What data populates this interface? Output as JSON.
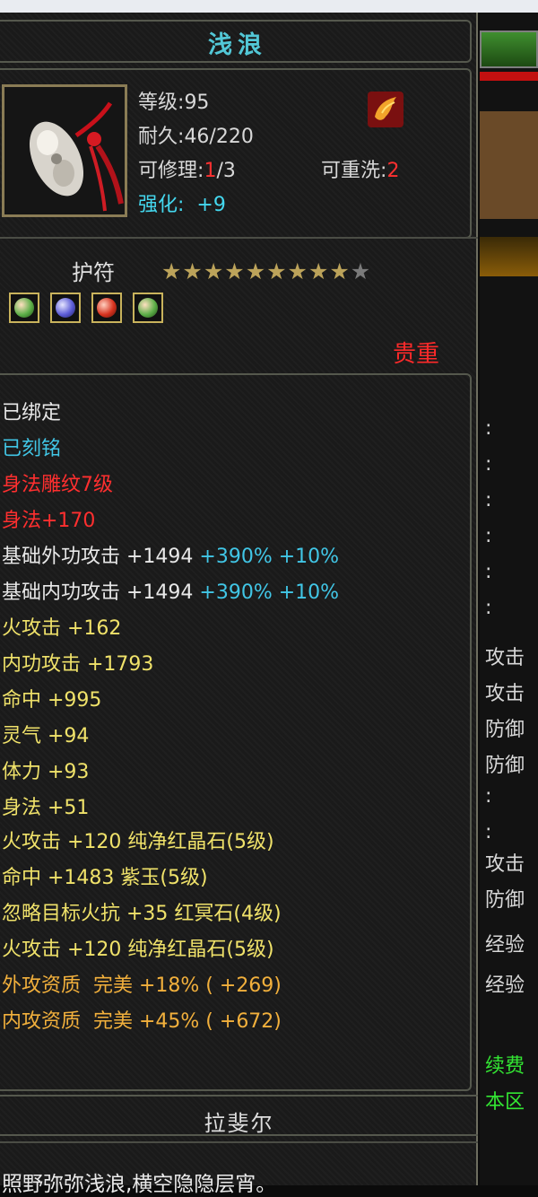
{
  "item": {
    "name": "浅浪",
    "level_label": "等级",
    "level_value": "95",
    "durability_label": "耐久",
    "durability_value": "46/220",
    "repair_label": "可修理",
    "repair_used": "1",
    "repair_max": "/3",
    "rewash_label": "可重洗",
    "rewash_value": "2",
    "enhance_label": "强化",
    "enhance_value": "+9",
    "type": "护符",
    "stars_filled": 9,
    "stars_total": 10,
    "rarity": "贵重",
    "gems": [
      "green-gem",
      "blue-gem",
      "red-gem",
      "green-gem"
    ],
    "icon": "jade-pendant-icon",
    "badge_icon": "phoenix-badge-icon"
  },
  "attributes": [
    {
      "text": "已绑定",
      "color": "white"
    },
    {
      "text": "已刻铭",
      "color": "cyan"
    },
    {
      "text": "身法雕纹7级",
      "color": "red"
    },
    {
      "text": "身法+170",
      "color": "red"
    },
    {
      "text": "基础外功攻击 +1494",
      "color": "white",
      "extra": " +390% +10%"
    },
    {
      "text": "基础内功攻击 +1494",
      "color": "white",
      "extra": " +390% +10%"
    },
    {
      "text": "火攻击 +162",
      "color": "yellow"
    },
    {
      "text": "内功攻击 +1793",
      "color": "yellow"
    },
    {
      "text": "命中 +995",
      "color": "yellow"
    },
    {
      "text": "灵气 +94",
      "color": "yellow"
    },
    {
      "text": "体力 +93",
      "color": "yellow"
    },
    {
      "text": "身法 +51",
      "color": "yellow"
    },
    {
      "text": "火攻击 +120 纯净红晶石(5级)",
      "color": "yellow"
    },
    {
      "text": "命中 +1483 紫玉(5级)",
      "color": "yellow"
    },
    {
      "text": "忽略目标火抗 +35 红冥石(4级)",
      "color": "yellow"
    },
    {
      "text": "火攻击 +120 纯净红晶石(5级)",
      "color": "yellow"
    },
    {
      "text": "外攻资质  完美 +18% ( +269)",
      "color": "gold"
    },
    {
      "text": "内攻资质  完美 +45% ( +672)",
      "color": "gold"
    }
  ],
  "owner": "拉斐尔",
  "description": "照野弥弥浅浪,横空隐隐层宵。",
  "background_window": {
    "labels": [
      "攻击",
      "攻击",
      "防御",
      "防御",
      "攻击",
      "防御",
      "经验",
      "经验",
      "续费",
      "本区"
    ],
    "colons": [
      ":",
      ":",
      ":",
      ":",
      ":",
      ":",
      ":",
      ":"
    ]
  },
  "colors": {
    "title": "#52c7d6",
    "rarity": "#ff2a2a",
    "attribute_yellow": "#f0e26a",
    "attribute_gold": "#f2b03c"
  }
}
